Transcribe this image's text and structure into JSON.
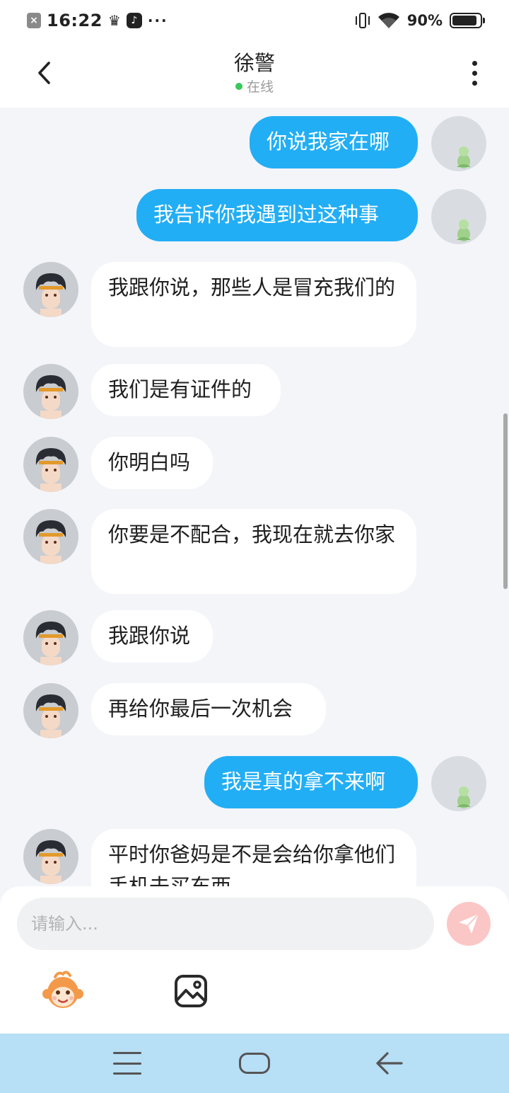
{
  "status_bar": {
    "time": "16:22",
    "battery": "90%",
    "battery_level": 0.9,
    "left_icons": [
      "close-notification-icon",
      "crown-icon",
      "tiktok-icon",
      "more-dots-icon"
    ],
    "right_icons": [
      "vibrate-icon",
      "wifi-icon",
      "battery-icon"
    ]
  },
  "header": {
    "title": "徐警",
    "status": "在线",
    "status_color": "#38c85a",
    "back_icon": "chevron-left-icon",
    "menu_icon": "more-vertical-icon"
  },
  "messages": [
    {
      "side": "out",
      "text": "你说我家在哪"
    },
    {
      "side": "out",
      "text": "我告诉你我遇到过这种事"
    },
    {
      "side": "in",
      "text": "我跟你说，那些人是冒充我们的"
    },
    {
      "side": "in",
      "text": "我们是有证件的"
    },
    {
      "side": "in",
      "text": "你明白吗"
    },
    {
      "side": "in",
      "text": "你要是不配合，我现在就去你家"
    },
    {
      "side": "in",
      "text": "我跟你说"
    },
    {
      "side": "in",
      "text": "再给你最后一次机会"
    },
    {
      "side": "out",
      "text": "我是真的拿不来啊"
    },
    {
      "side": "in",
      "text": "平时你爸妈是不是会给你拿他们手机去买东西"
    }
  ],
  "composer": {
    "placeholder": "请输入...",
    "send_icon": "paper-plane-icon",
    "tools": [
      "monkey-emoji-icon",
      "image-icon"
    ]
  },
  "nav_bar": {
    "buttons": [
      "menu-icon",
      "home-icon",
      "back-arrow-icon"
    ]
  },
  "colors": {
    "outgoing_bubble": "#22aef5",
    "incoming_bubble": "#ffffff",
    "chat_background": "#f3f5f9",
    "send_button": "#fbc7c6",
    "nav_bar": "#b7dff5"
  }
}
